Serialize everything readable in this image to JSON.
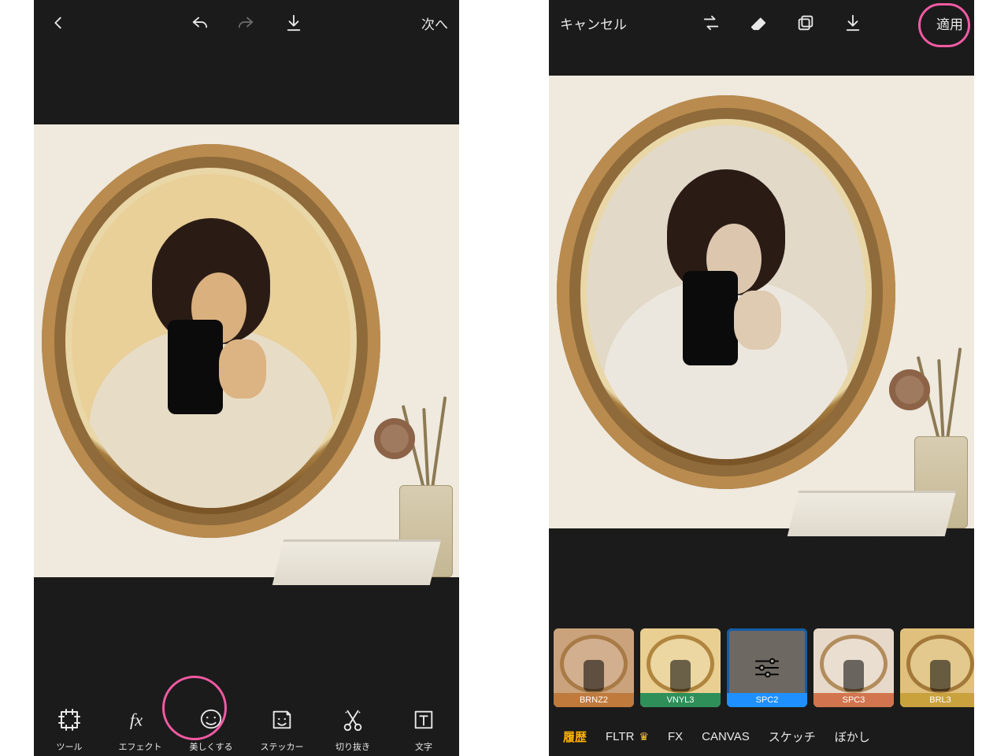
{
  "left": {
    "top": {
      "next": "次へ"
    },
    "tools": [
      {
        "key": "tools",
        "label": "ツール"
      },
      {
        "key": "effects",
        "label": "エフェクト"
      },
      {
        "key": "beautify",
        "label": "美しくする"
      },
      {
        "key": "sticker",
        "label": "ステッカー"
      },
      {
        "key": "cutout",
        "label": "切り抜き"
      },
      {
        "key": "text",
        "label": "文字"
      }
    ]
  },
  "right": {
    "top": {
      "cancel": "キャンセル",
      "apply": "適用"
    },
    "filters": [
      {
        "key": "brnz2",
        "label": "BRNZ2",
        "bg": "#caa27b",
        "tag": "#bf7a3c",
        "frame": "#a87a46"
      },
      {
        "key": "vnyl3",
        "label": "VNYL3",
        "bg": "#e9cf91",
        "tag": "#2e8f59",
        "frame": "#b0853e"
      },
      {
        "key": "spc2",
        "label": "SPC2",
        "bg": "#a9a097",
        "tag": "#1e90ff",
        "frame": "#7a6a55",
        "selected": true,
        "showSliders": true
      },
      {
        "key": "spc3",
        "label": "SPC3",
        "bg": "#e7d9c9",
        "tag": "#d2754f",
        "frame": "#b38c5c"
      },
      {
        "key": "brl3",
        "label": "BRL3",
        "bg": "#e0c07c",
        "tag": "#c9a23e",
        "frame": "#a3793a"
      }
    ],
    "tabs": [
      {
        "key": "history",
        "label": "履歴",
        "active": true
      },
      {
        "key": "fltr",
        "label": "FLTR",
        "crown": true
      },
      {
        "key": "fx",
        "label": "FX"
      },
      {
        "key": "canvas",
        "label": "CANVAS"
      },
      {
        "key": "sketch",
        "label": "スケッチ"
      },
      {
        "key": "blur",
        "label": "ぼかし"
      }
    ]
  }
}
